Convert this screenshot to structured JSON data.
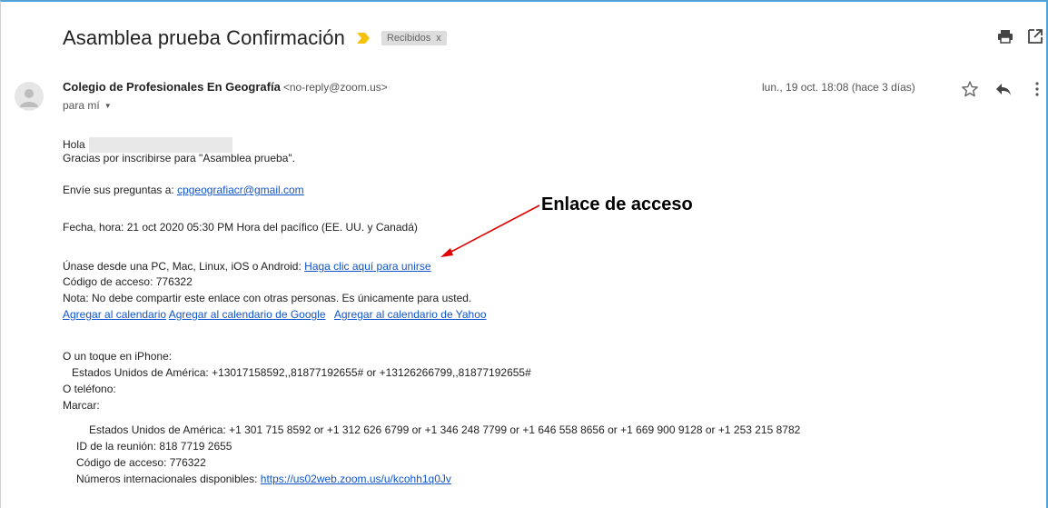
{
  "header": {
    "subject": "Asamblea prueba Confirmación",
    "label": "Recibidos",
    "label_remove": "x",
    "icons": [
      "print-icon",
      "open-in-new-window-icon"
    ]
  },
  "sender": {
    "name": "Colegio de Profesionales En Geografía",
    "email": "<no-reply@zoom.us>",
    "to": "para mí",
    "date": "lun., 19 oct. 18:08 (hace 3 días)",
    "icons": [
      "star-icon",
      "reply-icon",
      "more-vert-icon"
    ]
  },
  "body": {
    "greeting": "Hola",
    "thanks": "Gracias por inscribirse para \"Asamblea prueba\".",
    "questions_prefix": "Envíe sus preguntas a: ",
    "questions_email": "cpgeografiacr@gmail.com",
    "datetime": "Fecha, hora: 21 oct 2020 05:30 PM Hora del pacífico (EE. UU. y Canadá)",
    "join_prefix": "Únase desde una PC, Mac, Linux, iOS o Android: ",
    "join_link": "Haga clic aquí para unirse",
    "access_code": "Código de acceso: 776322",
    "note": "Nota: No debe compartir este enlace con otras personas. Es únicamente para usted.",
    "calendar_links": [
      "Agregar al calendario",
      "Agregar al calendario de Google",
      "Agregar al calendario de Yahoo"
    ],
    "iphone_title": "O un toque en iPhone:",
    "iphone_numbers": "Estados Unidos de América: +13017158592,,81877192655# or +13126266799,,81877192655#",
    "phone_title": "O teléfono:",
    "dial_title": "Marcar:",
    "dial_numbers": "Estados Unidos de América: +1 301 715 8592 or +1 312 626 6799 or +1 346 248 7799 or +1 646 558 8656 or +1 669 900 9128 or +1 253 215 8782",
    "meeting_id": "ID de la reunión: 818 7719 2655",
    "access_code_2": "Código de acceso: 776322",
    "intl_prefix": "Números internacionales disponibles: ",
    "intl_link": "https://us02web.zoom.us/u/kcohh1q0Jv"
  },
  "annotation": {
    "text": "Enlace de acceso",
    "color": "#e00000"
  },
  "colors": {
    "link": "#1155cc",
    "importance": "#f4c20d",
    "frame": "#4fa3d8"
  }
}
